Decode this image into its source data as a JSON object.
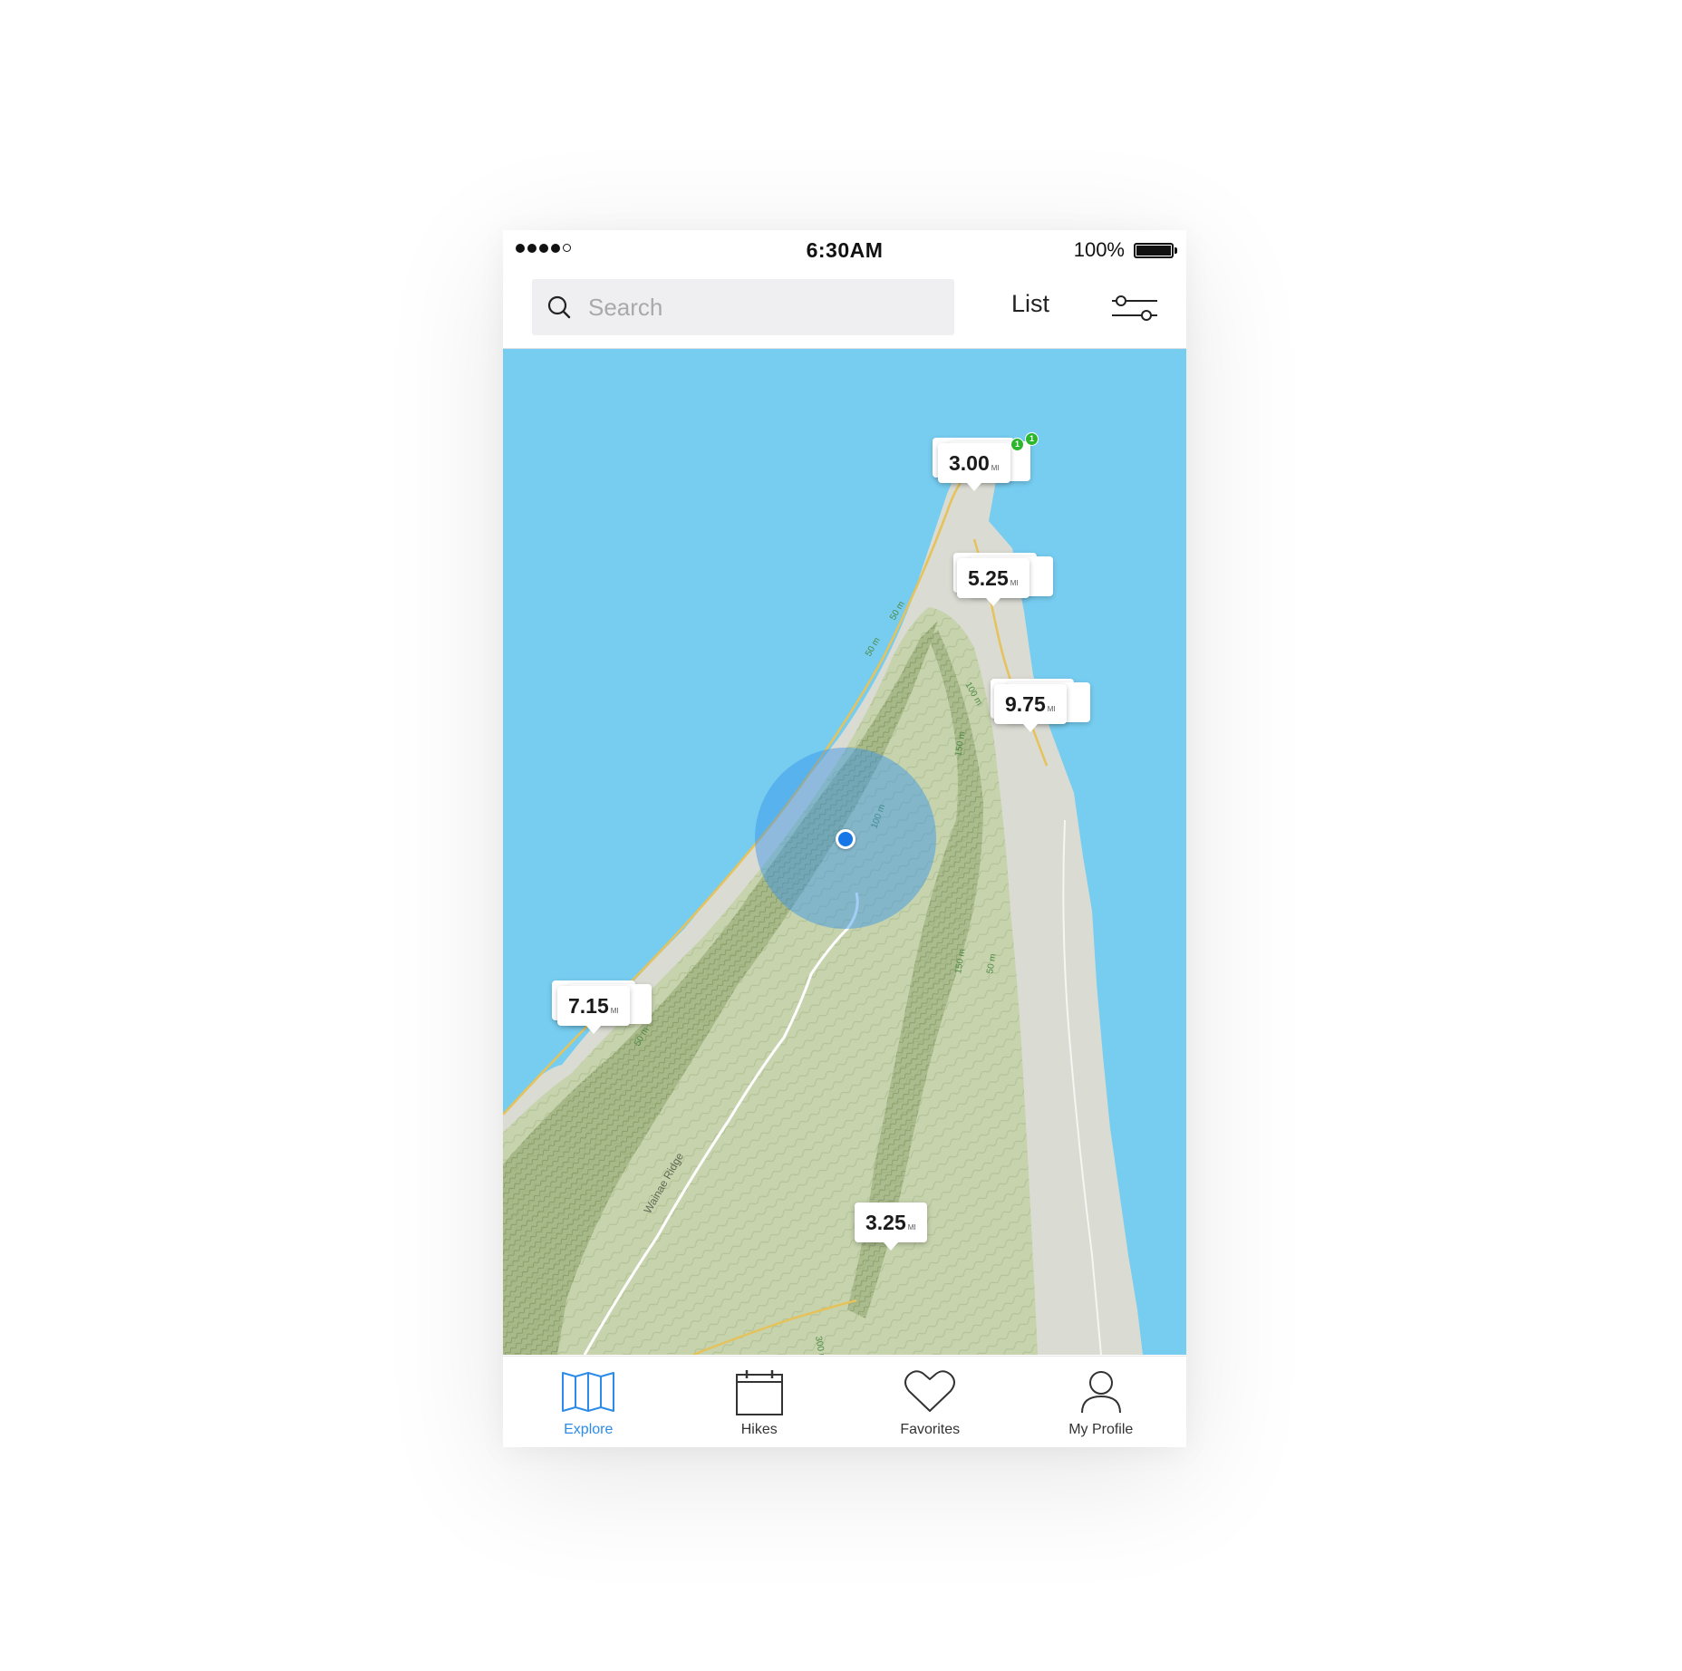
{
  "status_bar": {
    "time": "6:30AM",
    "battery_percent": "100%",
    "signal_bars": 4
  },
  "header": {
    "search": {
      "placeholder": "Search",
      "value": ""
    },
    "list_label": "List"
  },
  "map": {
    "ridge_label": "Wainae Ridge",
    "contour_labels": [
      "50 m",
      "100 m",
      "150 m",
      "100 m",
      "150 m",
      "50 m",
      "50 m",
      "300 m",
      "50 m"
    ],
    "trail_pins": [
      {
        "distance": "3.00",
        "unit": "MI",
        "badges": [
          "1",
          "1"
        ]
      },
      {
        "distance": "5.25",
        "unit": "MI"
      },
      {
        "distance": "9.75",
        "unit": "MI"
      },
      {
        "distance": "7.15",
        "unit": "MI"
      },
      {
        "distance": "3.25",
        "unit": "MI"
      }
    ]
  },
  "tabbar": {
    "tabs": [
      {
        "label": "Explore",
        "icon": "map-icon",
        "active": true
      },
      {
        "label": "Hikes",
        "icon": "calendar-icon",
        "active": false
      },
      {
        "label": "Favorites",
        "icon": "heart-icon",
        "active": false
      },
      {
        "label": "My Profile",
        "icon": "person-icon",
        "active": false
      }
    ]
  },
  "colors": {
    "water": "#76cdf0",
    "land": "#dadbd3",
    "terrain": "#c6d3ad",
    "accent": "#2b8be8",
    "location": "#1877e6",
    "badge": "#2cb62c"
  }
}
